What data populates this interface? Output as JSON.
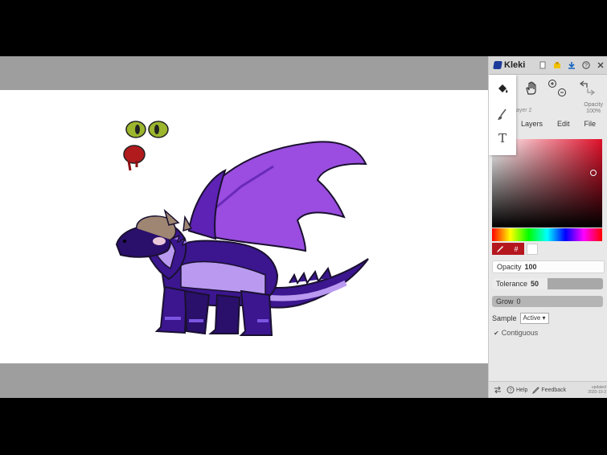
{
  "app": {
    "name": "Kleki",
    "brand_color": "#1b3a9b",
    "accent_color": "#b5171f"
  },
  "toolbar": {
    "tools": [
      {
        "name": "fill-bucket-icon",
        "active": true
      },
      {
        "name": "brush-icon",
        "active": false
      },
      {
        "name": "text-icon",
        "label": "T",
        "active": false
      }
    ]
  },
  "layer": {
    "name": "ayer 2",
    "opacity_label": "Opacity",
    "opacity_value": "100%"
  },
  "tabs": [
    "Layers",
    "Edit",
    "File"
  ],
  "color": {
    "current": "#b5171f",
    "hash_label": "#",
    "secondary": "#ffffff"
  },
  "fill_settings": {
    "opacity": {
      "label": "Opacity",
      "value": "100",
      "level": 1.0
    },
    "tolerance": {
      "label": "Tolerance",
      "value": "50",
      "level": 0.5
    },
    "grow": {
      "label": "Grow",
      "value": "0",
      "level": 0
    },
    "sample_label": "Sample",
    "sample_value": "Active",
    "contiguous_label": "Contiguous",
    "contiguous_checked": true
  },
  "bottom": {
    "help": "Help",
    "feedback": "Feedback",
    "updated_line1": "updated",
    "updated_line2": "2020-10-2"
  }
}
